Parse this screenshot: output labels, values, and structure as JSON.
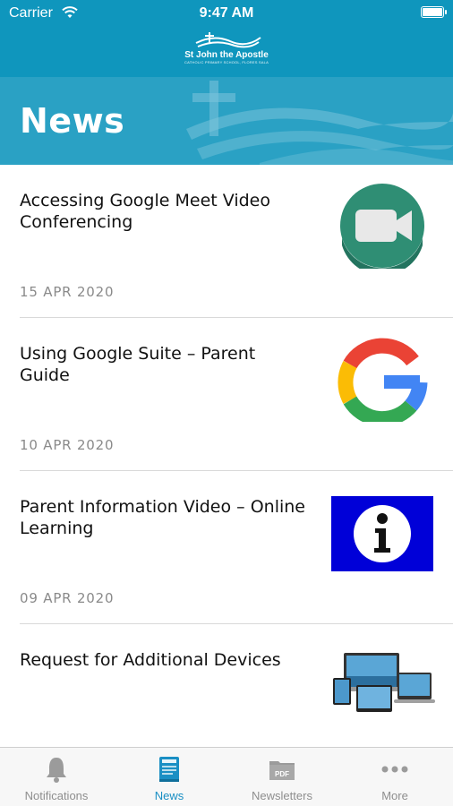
{
  "status_bar": {
    "carrier": "Carrier",
    "time": "9:47 AM"
  },
  "header": {
    "logo_name": "St John the Apostle",
    "logo_subtitle": "CATHOLIC PRIMARY SCHOOL, FLORES SALA",
    "title": "News"
  },
  "colors": {
    "header": "#0f96bd",
    "banner": "#2aa1c4",
    "accent": "#1a8fc4"
  },
  "news": [
    {
      "title": "Accessing Google Meet Video Conferencing",
      "date": "15 APR 2020",
      "thumb": "google-meet-icon"
    },
    {
      "title": "Using Google Suite – Parent Guide",
      "date": "10 APR 2020",
      "thumb": "google-g-icon"
    },
    {
      "title": "Parent Information Video – Online Learning",
      "date": "09 APR 2020",
      "thumb": "info-icon"
    },
    {
      "title": "Request for Additional Devices",
      "date": "",
      "thumb": "devices-image"
    }
  ],
  "tabs": [
    {
      "label": "Notifications",
      "icon": "bell-icon",
      "active": false
    },
    {
      "label": "News",
      "icon": "news-book-icon",
      "active": true
    },
    {
      "label": "Newsletters",
      "icon": "pdf-folder-icon",
      "active": false
    },
    {
      "label": "More",
      "icon": "more-dots-icon",
      "active": false
    }
  ]
}
